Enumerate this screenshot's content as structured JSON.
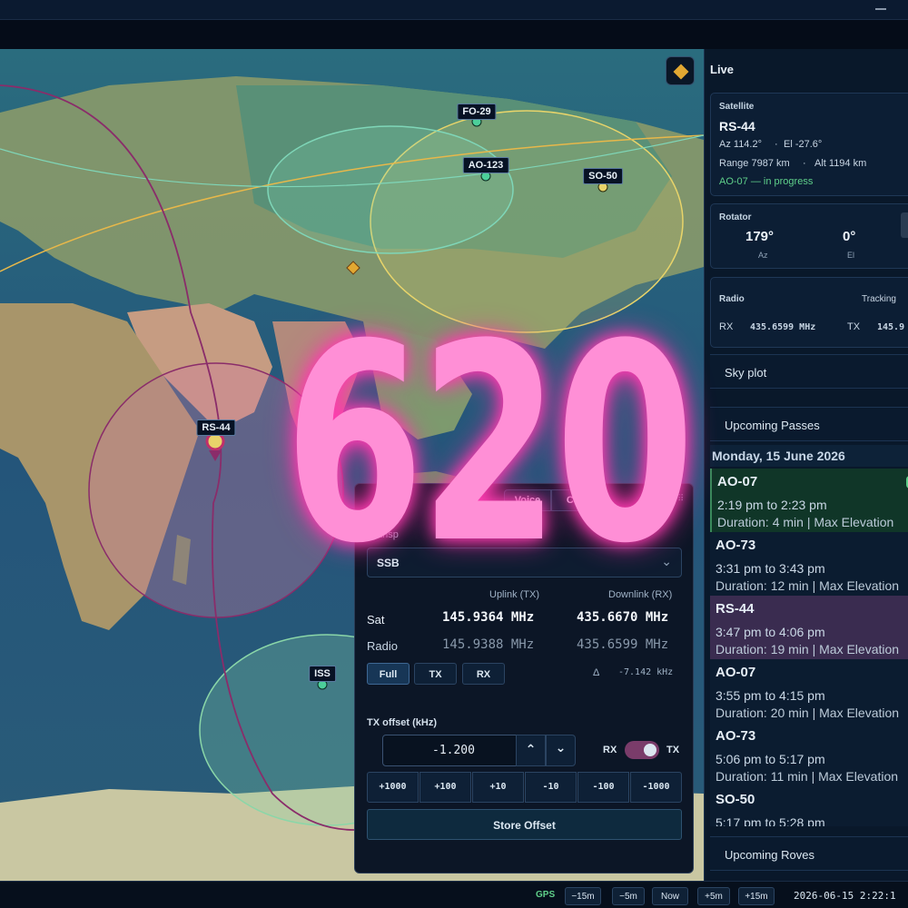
{
  "sidebar": {
    "live_label": "Live",
    "satellite": {
      "section_label": "Satellite",
      "name": "RS-44",
      "az": "Az 114.2°",
      "el": "El -27.6°",
      "separator": "·",
      "range": "Range 7987 km",
      "alt": "Alt 1194 km",
      "status": "AO-07 — in progress"
    },
    "rotator": {
      "section_label": "Rotator",
      "az_value": "179°",
      "az_label": "Az",
      "el_value": "0°",
      "el_label": "El"
    },
    "radio": {
      "section_label": "Radio",
      "tracking_label": "Tracking",
      "rx_label": "RX",
      "rx_value": "435.6599 MHz",
      "tx_label": "TX",
      "tx_value": "145.9"
    },
    "sky_plot_label": "Sky plot",
    "upcoming_passes_label": "Upcoming Passes",
    "day_header": "Monday, 15 June 2026",
    "passes": [
      {
        "name": "AO-07",
        "time": "2:19 pm to 2:23 pm",
        "detail": "Duration: 4 min | Max Elevation"
      },
      {
        "name": "AO-73",
        "time": "3:31 pm to 3:43 pm",
        "detail": "Duration: 12 min | Max Elevation"
      },
      {
        "name": "RS-44",
        "time": "3:47 pm to 4:06 pm",
        "detail": "Duration: 19 min | Max Elevation"
      },
      {
        "name": "AO-07",
        "time": "3:55 pm to 4:15 pm",
        "detail": "Duration: 20 min | Max Elevation"
      },
      {
        "name": "AO-73",
        "time": "5:06 pm to 5:17 pm",
        "detail": "Duration: 11 min | Max Elevation"
      },
      {
        "name": "SO-50",
        "time": "5:17 pm to 5:28 pm",
        "detail": ""
      }
    ],
    "upcoming_roves_label": "Upcoming Roves"
  },
  "map": {
    "satellites": [
      "FO-29",
      "AO-123",
      "SO-50",
      "RS-44",
      "ISS"
    ]
  },
  "panel": {
    "title": "RS-",
    "voice_label": "Voice",
    "cw_label": "CW",
    "transponder_label": "Transp",
    "mode_suffix": "mode",
    "mode_value": "SSB",
    "uplink_header": "Uplink (TX)",
    "downlink_header": "Downlink (RX)",
    "sat_label": "Sat",
    "sat_uplink": "145.9364 MHz",
    "sat_downlink": "435.6670 MHz",
    "radio_label": "Radio",
    "radio_uplink": "145.9388 MHz",
    "radio_downlink": "435.6599 MHz",
    "mode_buttons": [
      "Full",
      "TX",
      "RX"
    ],
    "delta_symbol": "Δ",
    "delta_value": "-7.142 kHz",
    "tx_offset_label": "TX offset (kHz)",
    "tx_offset_value": "-1.200",
    "rx_toggle_label": "RX",
    "tx_toggle_label": "TX",
    "step_buttons": [
      "+1000",
      "+100",
      "+10",
      "-10",
      "-100",
      "-1000"
    ],
    "store_label": "Store Offset"
  },
  "bottombar": {
    "gps_label": "GPS",
    "buttons": [
      "−15m",
      "−5m",
      "Now",
      "+5m",
      "+15m"
    ],
    "datetime": "2026-06-15 2:22:1"
  },
  "overlay": {
    "number": "620"
  },
  "colors": {
    "accent_green": "#5fd08a",
    "overlay_pink": "#ff8fd6",
    "footprint_yellow": "#e8d46a",
    "footprint_teal": "#7fd6b8",
    "rs44_footprint": "#d27aa4",
    "ground_track": "#8a2c6a"
  }
}
